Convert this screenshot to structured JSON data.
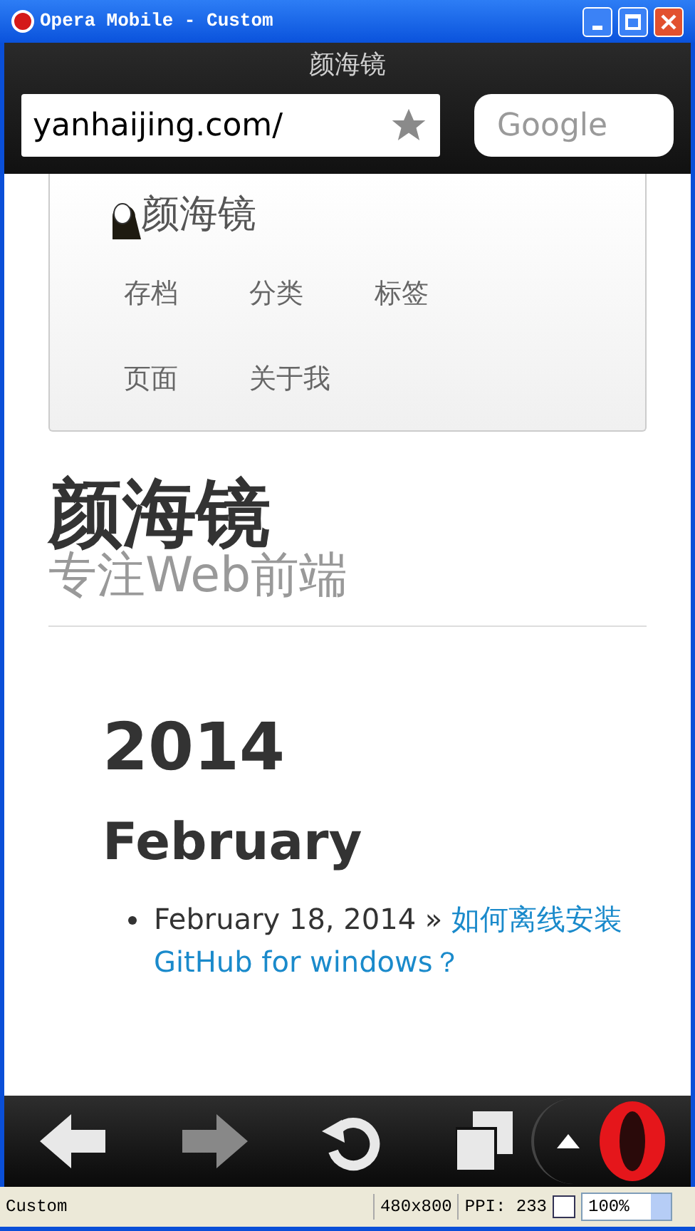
{
  "window": {
    "title": "Opera Mobile - Custom"
  },
  "page_title": "颜海镜",
  "address": {
    "value": "yanhaijing.com/"
  },
  "search": {
    "placeholder": "Google"
  },
  "site_nav": {
    "brand": "颜海镜",
    "items": [
      {
        "label": "存档"
      },
      {
        "label": "分类"
      },
      {
        "label": "标签"
      },
      {
        "label": "页面"
      },
      {
        "label": "关于我"
      }
    ]
  },
  "site_header": {
    "title": "颜海镜",
    "subtitle": "专注Web前端"
  },
  "archive": {
    "year": "2014",
    "month": "February",
    "posts": [
      {
        "date": "February 18, 2014 »",
        "title": "如何离线安装GitHub for windows？"
      }
    ]
  },
  "status_bar": {
    "profile": "Custom",
    "resolution": "480x800",
    "ppi": "PPI: 233",
    "zoom": "100%"
  }
}
